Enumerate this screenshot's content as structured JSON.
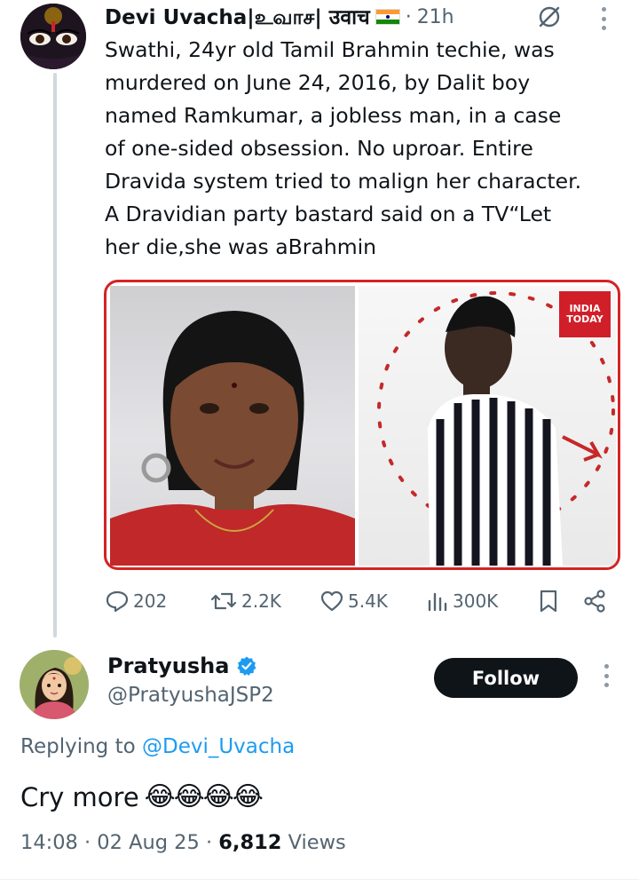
{
  "tweet": {
    "author_name": "Devi Uvacha|உவாச| उवाच",
    "time": "21h",
    "body_lines": [
      "Swathi, 24yr old Tamil Brahmin techie, was",
      "murdered on June 24, 2016, by Dalit boy",
      "named Ramkumar, a jobless man, in a case",
      "of one-sided obsession. No uproar. Entire",
      "Dravida system tried to malign her character.",
      "A Dravidian party bastard said on a TV“Let",
      "her die,she was aBrahmin"
    ],
    "media_logo": [
      "INDIA",
      "TODAY"
    ],
    "stats": {
      "replies": "202",
      "reposts": "2.2K",
      "likes": "5.4K",
      "views": "300K"
    }
  },
  "reply": {
    "author_name": "Pratyusha",
    "handle": "@PratyushaJSP2",
    "follow_label": "Follow",
    "replying_prefix": "Replying to",
    "replying_to": "@Devi_Uvacha",
    "text": "Cry more",
    "emoji": "😂",
    "timestamp": "14:08 · 02 Aug 25 ·",
    "views_count": "6,812",
    "views_label": "Views"
  },
  "colors": {
    "accent": "#1d9bf0",
    "secondary_text": "#536471",
    "border_red": "#d32424",
    "follow_bg": "#0f1419"
  },
  "icons": [
    "grok-icon",
    "more-icon",
    "reply-icon",
    "repost-icon",
    "like-icon",
    "views-icon",
    "bookmark-icon",
    "share-icon",
    "verified-icon"
  ]
}
